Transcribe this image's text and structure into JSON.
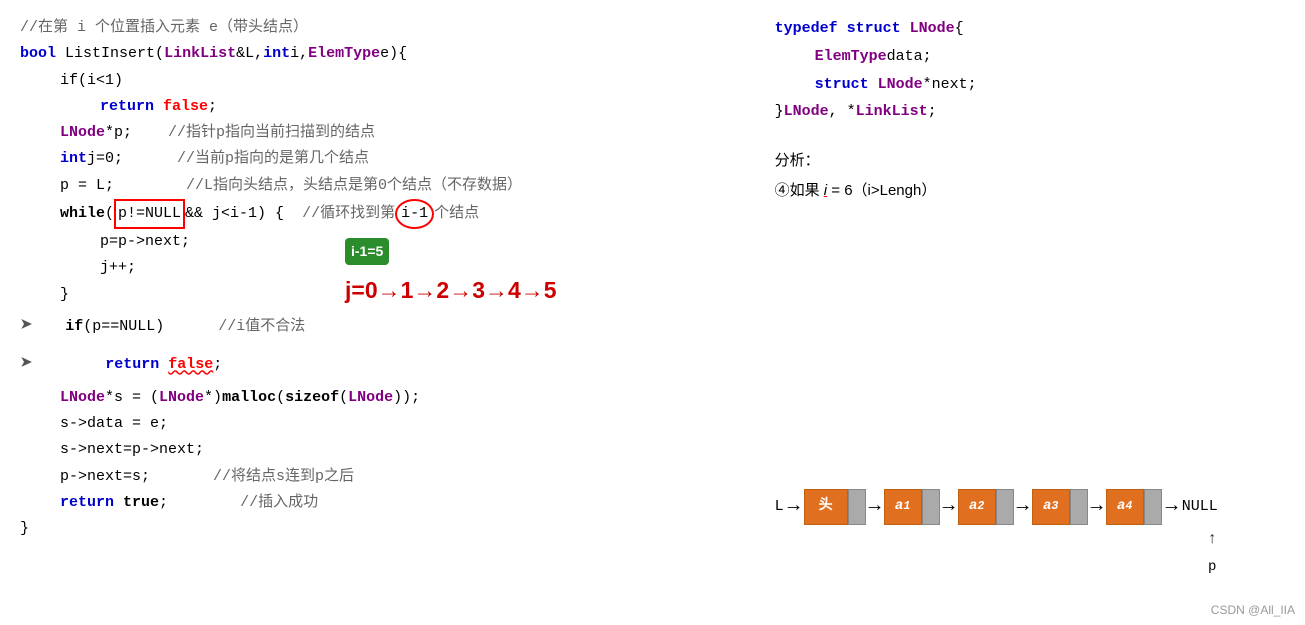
{
  "header": {
    "comment1": "//在第 i 个位置插入元素 e（带头结点）"
  },
  "code": {
    "line1": "bool ListInsert(LinkList &L, int i, ElemType e){",
    "line2": "if(i<1)",
    "line3": "return false;",
    "line4": "LNode *p;",
    "line4_comment": "//指针p指向当前扫描到的结点",
    "line5": "int j=0;",
    "line5_comment": "//当前p指向的是第几个结点",
    "line6": "p = L;",
    "line6_comment": "//L指向头结点，头结点是第0个结点（不存数据）",
    "line7": "while (p!=NULL && j<i-1) {",
    "line7_comment": "//循环找到第 i-1 个结点",
    "line8": "p=p->next;",
    "line9": "j++;",
    "line10": "}",
    "line11": "if(p==NULL)",
    "line11_comment": "//i值不合法",
    "line12": "return false;",
    "line13": "LNode *s = (LNode *)malloc(sizeof(LNode));",
    "line14": "s->data = e;",
    "line15": "s->next=p->next;",
    "line16": "p->next=s;",
    "line16_comment": "//将结点s连到p之后",
    "line17": "return true;",
    "line17_comment": "//插入成功",
    "line18": "}"
  },
  "struct_code": {
    "typedef": "typedef struct LNode{",
    "field1": "    ElemType data;",
    "field2": "    struct LNode *next;",
    "closing": "}LNode, *LinkList;"
  },
  "analysis": {
    "title": "分析：",
    "item4": "④如果 i = 6（i>Lengh）"
  },
  "annotations": {
    "badge": "i-1=5",
    "sequence": "j=0→1→2→3→4→5"
  },
  "linked_list": {
    "label": "L",
    "nodes": [
      "头",
      "a₁",
      "a₂",
      "a₃",
      "a₄"
    ],
    "null_label": "NULL",
    "p_label": "p"
  },
  "watermark": "CSDN @All_IIA"
}
